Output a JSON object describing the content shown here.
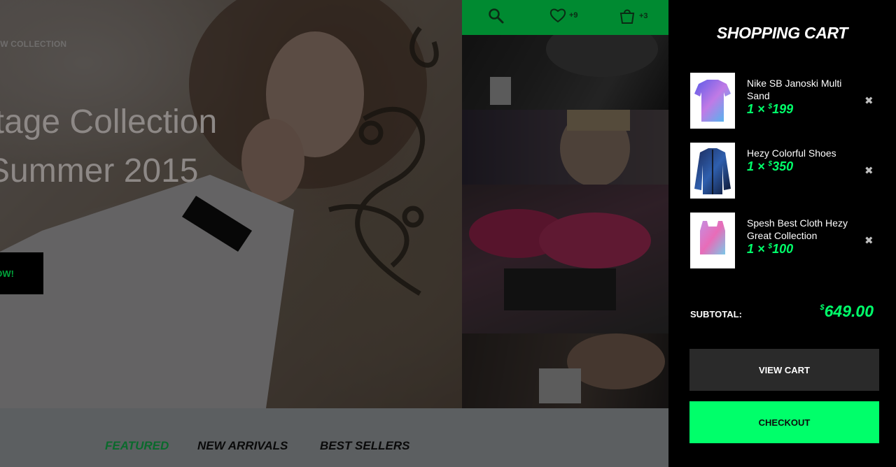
{
  "hero": {
    "eyebrow": "EW COLLECTION",
    "title_line1": "itage Collection",
    "title_line2": "Summer 2015",
    "cta_label": "OW!"
  },
  "top_bar": {
    "search_icon": "search-icon",
    "wishlist_icon": "heart-icon",
    "wishlist_count": "+9",
    "cart_icon": "shopping-bag-icon",
    "cart_count": "+3",
    "background": "#008a31"
  },
  "tabs": [
    {
      "label": "FEATURED",
      "active": true
    },
    {
      "label": "NEW  ARRIVALS",
      "active": false
    },
    {
      "label": "BEST SELLERS",
      "active": false
    }
  ],
  "cart": {
    "title": "SHOPPING CART",
    "items": [
      {
        "name": "Nike SB Janoski Multi Sand",
        "qty": "1 ×",
        "currency": "$",
        "price": "199"
      },
      {
        "name": "Hezy Colorful Shoes",
        "qty": "1 ×",
        "currency": "$",
        "price": "350"
      },
      {
        "name": "Spesh Best Cloth Hezy Great Collection",
        "qty": "1 ×",
        "currency": "$",
        "price": "100"
      }
    ],
    "remove_icon": "close-icon",
    "subtotal_label": "SUBTOTAL:",
    "subtotal_currency": "$",
    "subtotal_value": "649.00",
    "view_cart_label": "VIEW CART",
    "checkout_label": "CHECKOUT",
    "accent": "#00ff6a"
  }
}
